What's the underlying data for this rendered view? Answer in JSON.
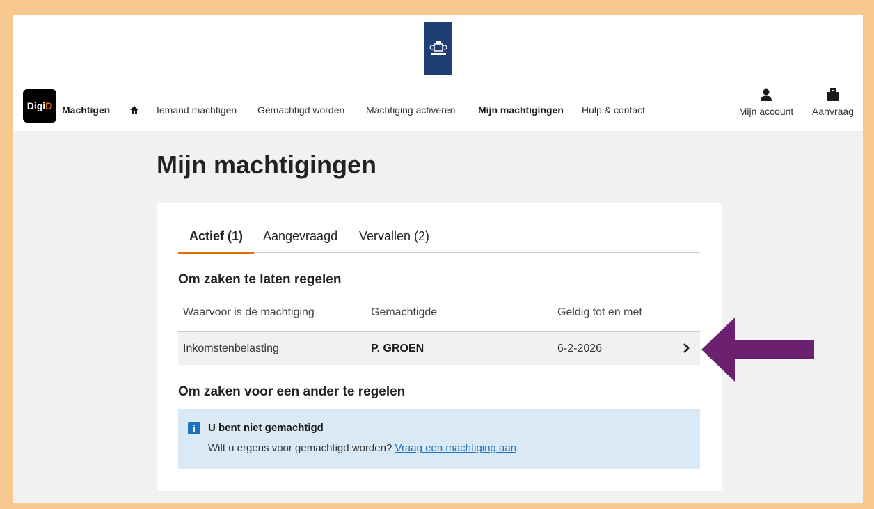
{
  "header": {
    "logo_text_1": "Digi",
    "logo_text_2": "D",
    "app_name": "Machtigen",
    "nav": [
      {
        "label": "Iemand machtigen"
      },
      {
        "label": "Gemachtigd worden"
      },
      {
        "label": "Machtiging activeren"
      },
      {
        "label": "Mijn machtigingen"
      },
      {
        "label": "Hulp & contact"
      }
    ],
    "account_label": "Mijn account",
    "aanvraag_label": "Aanvraag"
  },
  "page": {
    "title": "Mijn machtigingen"
  },
  "tabs": [
    {
      "label": "Actief (1)"
    },
    {
      "label": "Aangevraagd"
    },
    {
      "label": "Vervallen (2)"
    }
  ],
  "section1": {
    "heading": "Om zaken te laten regelen",
    "columns": [
      "Waarvoor is de machtiging",
      "Gemachtigde",
      "Geldig tot en met"
    ],
    "rows": [
      {
        "subject": "Inkomstenbelasting",
        "authorized": "P. GROEN",
        "valid_until": "6-2-2026"
      }
    ]
  },
  "section2": {
    "heading": "Om zaken voor een ander te regelen",
    "info_icon": "i",
    "info_title": "U bent niet gemachtigd",
    "info_text_prefix": "Wilt u ergens voor gemachtigd worden? ",
    "info_link": "Vraag een machtiging aan",
    "info_text_suffix": "."
  },
  "colors": {
    "accent": "#e17000",
    "rijks_blue": "#1f3f74",
    "info_bg": "#d9e9f5",
    "annotation_arrow": "#6b2070",
    "frame": "#f6c88f"
  }
}
